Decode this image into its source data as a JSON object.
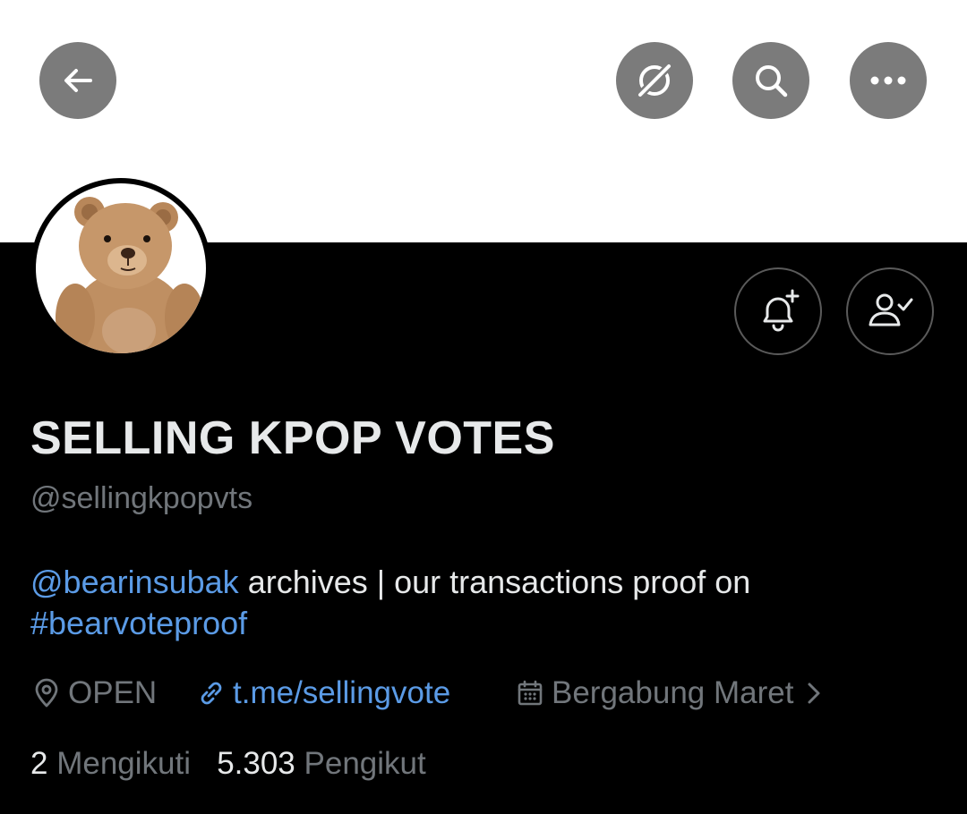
{
  "profile": {
    "display_name": "SELLING KPOP VOTES",
    "handle": "@sellingkpopvts",
    "bio": {
      "mention": "@bearinsubak",
      "text": " archives | our transactions proof on ",
      "hashtag": "#bearvoteproof"
    },
    "location": "OPEN",
    "website": "t.me/sellingvote",
    "joined": "Bergabung Maret",
    "following_count": "2",
    "following_label": "Mengikuti",
    "followers_count": "5.303",
    "followers_label": "Pengikut"
  },
  "icons": {
    "back": "arrow-left-icon",
    "grok": "grok-icon",
    "search": "search-icon",
    "more": "more-dots-icon",
    "notify": "bell-plus-icon",
    "following": "person-check-icon",
    "location": "location-pin-icon",
    "link": "link-icon",
    "calendar": "calendar-icon"
  },
  "colors": {
    "background": "#000000",
    "banner": "#ffffff",
    "link": "#5b9be6",
    "text_primary": "#e7e9ea",
    "text_secondary": "#71767b",
    "top_button": "#7b7b7b"
  }
}
